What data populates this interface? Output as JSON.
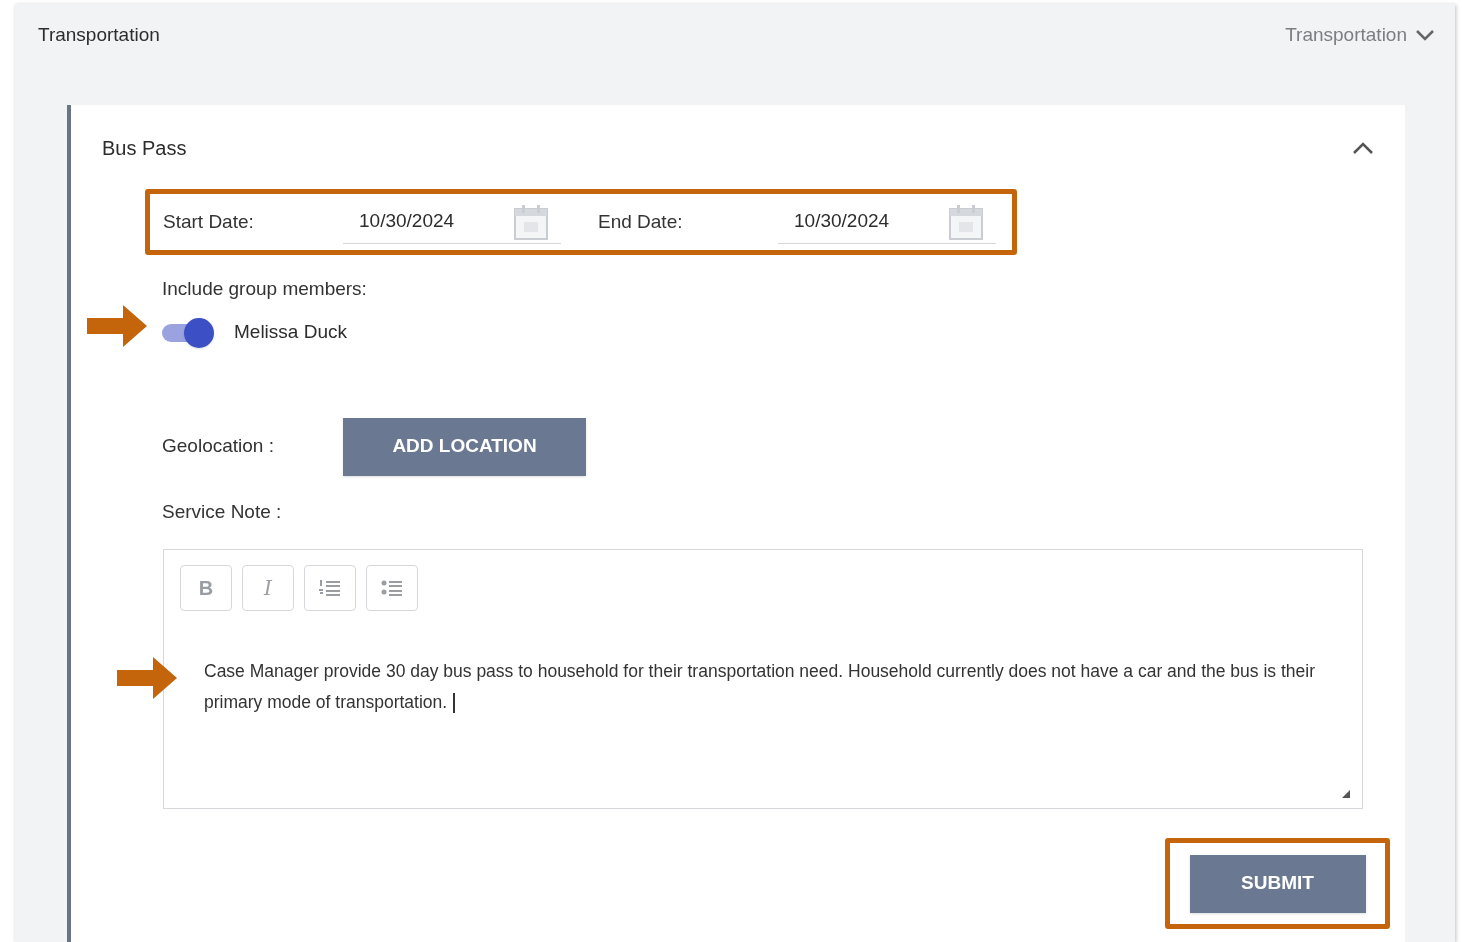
{
  "header": {
    "title": "Transportation",
    "dropdown": "Transportation"
  },
  "section": {
    "title": "Bus Pass",
    "expanded": true
  },
  "dates": [
    {
      "label": "Start Date:",
      "value": "10/30/2024"
    },
    {
      "label": "End Date:",
      "value": "10/30/2024"
    }
  ],
  "group": {
    "label": "Include group members:",
    "members": [
      {
        "name": "Melissa Duck",
        "on": true
      }
    ]
  },
  "geolocation": {
    "label": "Geolocation :",
    "button": "ADD LOCATION"
  },
  "service_note": {
    "label": "Service Note :",
    "toolbar": [
      {
        "kind": "bold",
        "text": "B"
      },
      {
        "kind": "italic",
        "text": "I"
      },
      {
        "kind": "numbered"
      },
      {
        "kind": "bulleted"
      }
    ],
    "value": "Case Manager provide 30 day bus pass to household for their transportation need. Household currently does not have a car and the bus is their primary mode of transportation."
  },
  "submit": "SUBMIT"
}
